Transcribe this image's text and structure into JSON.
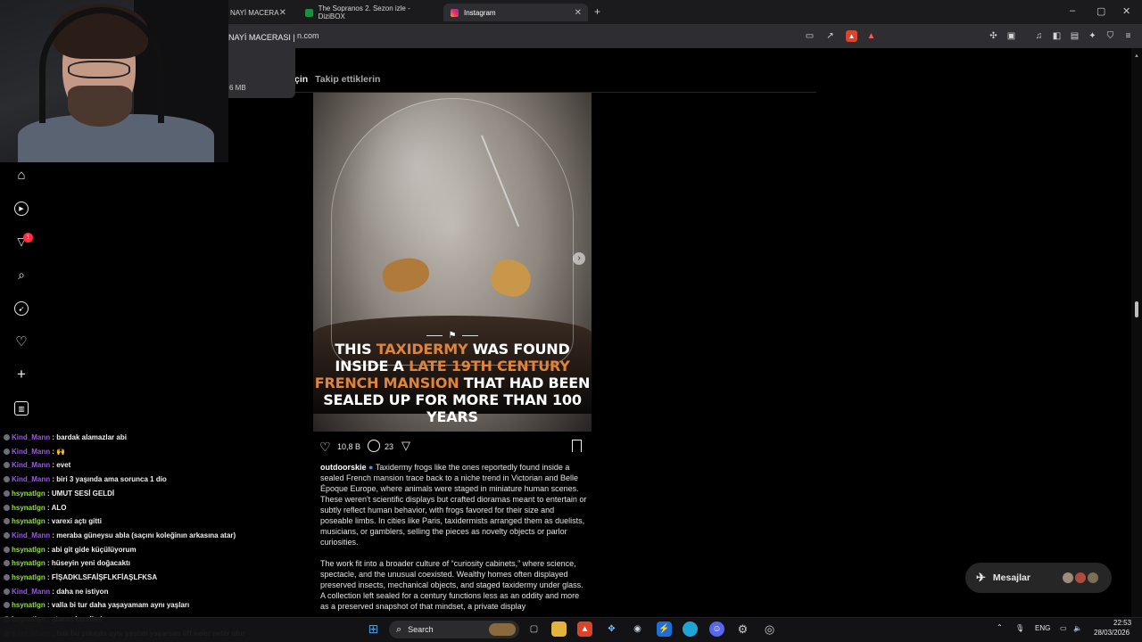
{
  "browser": {
    "tabs": [
      {
        "label": "NAYİ MACERA",
        "active": false
      },
      {
        "label": "The Sopranos 2. Sezon izle - DiziBOX",
        "active": false
      },
      {
        "label": "Instagram",
        "active": true
      }
    ],
    "new_tab": "+",
    "url": "n.com",
    "window_controls": [
      "–",
      "▢",
      "✕"
    ]
  },
  "tab_preview": {
    "title": "NAYİ MACERASI |",
    "size": "6 MB"
  },
  "feed": {
    "tab_for_you": "çin",
    "tab_following": "Takip ettiklerin"
  },
  "post": {
    "image_caption": {
      "part1": "THIS ",
      "highlight1": "TAXIDERMY",
      "part2": " WAS FOUND INSIDE A ",
      "highlight2": "LATE 19TH CENTURY FRENCH MANSION",
      "part3": " THAT HAD BEEN SEALED UP FOR MORE THAN 100 YEARS"
    },
    "likes": "10,8 B",
    "comments": "23",
    "author": "outdoorskie",
    "description_p1": "Taxidermy frogs like the ones reportedly found inside a sealed French mansion trace back to a niche trend in Victorian and Belle Époque Europe, where animals were staged in miniature human scenes. These weren't scientific displays but crafted dioramas meant to entertain or subtly reflect human behavior, with frogs favored for their size and poseable limbs. In cities like Paris, taxidermists arranged them as duelists, musicians, or gamblers, selling the pieces as novelty objects or parlor curiosities.",
    "description_p2": "The work fit into a broader culture of “curiosity cabinets,” where science, spectacle, and the unusual coexisted. Wealthy homes often displayed preserved insects, mechanical objects, and staged taxidermy under glass. A collection left sealed for a century functions less as an oddity and more as a preserved snapshot of that mindset, a private display"
  },
  "nav": {
    "notification_count": "1"
  },
  "chat": [
    {
      "user": "Kind_Mann",
      "msg": "bardak alamazlar abi",
      "color": "#9b59e8"
    },
    {
      "user": "Kind_Mann",
      "msg": "🙌",
      "color": "#9b59e8"
    },
    {
      "user": "Kind_Mann",
      "msg": "evet",
      "color": "#9b59e8"
    },
    {
      "user": "Kind_Mann",
      "msg": "biri 3 yaşında ama sorunca 1 dio",
      "color": "#9b59e8"
    },
    {
      "user": "hsynatlgn",
      "msg": "UMUT SESİ GELDİ",
      "color": "#8ee04a"
    },
    {
      "user": "hsynatlgn",
      "msg": "ALO",
      "color": "#8ee04a"
    },
    {
      "user": "hsynatlgn",
      "msg": "varexi açtı gitti",
      "color": "#8ee04a"
    },
    {
      "user": "Kind_Mann",
      "msg": "meraba güneysu abla (saçını koleğinın arkasına atar)",
      "color": "#9b59e8"
    },
    {
      "user": "hsynatlgn",
      "msg": "abi git gide küçülüyorum",
      "color": "#8ee04a"
    },
    {
      "user": "hsynatlgn",
      "msg": "hüseyin yeni doğacaktı",
      "color": "#8ee04a"
    },
    {
      "user": "hsynatlgn",
      "msg": "FİŞADKLSFAİŞFLKFİAŞLFKSA",
      "color": "#8ee04a"
    },
    {
      "user": "Kind_Mann",
      "msg": "daha ne istiyon",
      "color": "#9b59e8"
    },
    {
      "user": "hsynatlgn",
      "msg": "valla bi tur daha yaşayamam aynı yaşları",
      "color": "#8ee04a"
    },
    {
      "user": "hsynatlgn",
      "msg": "atarım kendimi",
      "color": "#8ee04a"
    },
    {
      "user": "Kind_Mann",
      "msg": "bak bu zekayla aynı yaşları yaşarsan üff neler neler olur",
      "color": "#9b59e8"
    }
  ],
  "messages_button": {
    "label": "Mesajlar"
  },
  "taskbar": {
    "search_label": "Search",
    "lang": "ENG",
    "time": "22:53",
    "date": "28/03/2026"
  },
  "colors": {
    "accent_orange": "#e0843a",
    "page_bg": "#000000",
    "chat_purple": "#9b59e8",
    "chat_green": "#8ee04a"
  }
}
